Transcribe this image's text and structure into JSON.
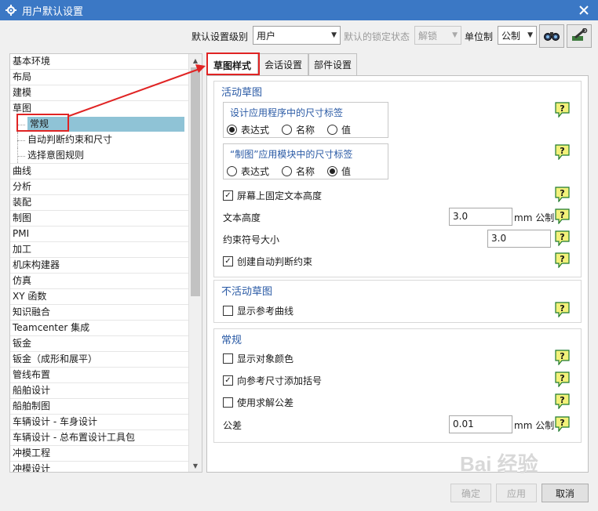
{
  "window": {
    "title": "用户默认设置"
  },
  "toolbar": {
    "level_label": "默认设置级别",
    "level_value": "用户",
    "lock_label": "默认的锁定状态",
    "lock_value": "解锁",
    "unit_label": "单位制",
    "unit_value": "公制"
  },
  "tree": {
    "items": [
      {
        "label": "基本环境"
      },
      {
        "label": "布局"
      },
      {
        "label": "建模"
      },
      {
        "label": "草图"
      },
      {
        "label": "常规"
      },
      {
        "label": "自动判断约束和尺寸"
      },
      {
        "label": "选择意图规则"
      },
      {
        "label": "曲线"
      },
      {
        "label": "分析"
      },
      {
        "label": "装配"
      },
      {
        "label": "制图"
      },
      {
        "label": "PMI"
      },
      {
        "label": "加工"
      },
      {
        "label": "机床构建器"
      },
      {
        "label": "仿真"
      },
      {
        "label": "XY 函数"
      },
      {
        "label": "知识融合"
      },
      {
        "label": "Teamcenter 集成"
      },
      {
        "label": "钣金"
      },
      {
        "label": "钣金（成形和展平）"
      },
      {
        "label": "管线布置"
      },
      {
        "label": "船舶设计"
      },
      {
        "label": "船舶制图"
      },
      {
        "label": "车辆设计 - 车身设计"
      },
      {
        "label": "车辆设计 - 总布置设计工具包"
      },
      {
        "label": "冲模工程"
      },
      {
        "label": "冲模设计"
      }
    ]
  },
  "tabs": [
    {
      "label": "草图样式"
    },
    {
      "label": "会话设置"
    },
    {
      "label": "部件设置"
    }
  ],
  "active_sketch": {
    "title": "活动草图",
    "app_dims": {
      "title": "设计应用程序中的尺寸标签",
      "options": [
        "表达式",
        "名称",
        "值"
      ],
      "selected": "表达式"
    },
    "drafting_dims": {
      "title": "“制图”应用模块中的尺寸标签",
      "options": [
        "表达式",
        "名称",
        "值"
      ],
      "selected": "值"
    },
    "fix_text_height": {
      "label": "屏幕上固定文本高度",
      "checked": true
    },
    "text_height": {
      "label": "文本高度",
      "value": "3.0",
      "unit": "mm 公制"
    },
    "constraint_symbol_size": {
      "label": "约束符号大小",
      "value": "3.0"
    },
    "create_auto_constraints": {
      "label": "创建自动判断约束",
      "checked": true
    }
  },
  "inactive_sketch": {
    "title": "不活动草图",
    "show_ref_curves": {
      "label": "显示参考曲线",
      "checked": false
    }
  },
  "general": {
    "title": "常规",
    "show_object_color": {
      "label": "显示对象颜色",
      "checked": false
    },
    "add_parentheses": {
      "label": "向参考尺寸添加括号",
      "checked": true
    },
    "use_solve_tolerance": {
      "label": "使用求解公差",
      "checked": false
    },
    "tolerance": {
      "label": "公差",
      "value": "0.01",
      "unit": "mm 公制"
    }
  },
  "help_icon_text": "?",
  "footer": {
    "ok": "确定",
    "apply": "应用",
    "cancel": "取消"
  },
  "watermark": "Bai 经验",
  "colors": {
    "titlebar": "#3b78c5",
    "accent_blue": "#2a5aa5",
    "highlight": "#8fc3d6",
    "annotation_red": "#e02424",
    "help_yellow": "#f3f17a"
  }
}
